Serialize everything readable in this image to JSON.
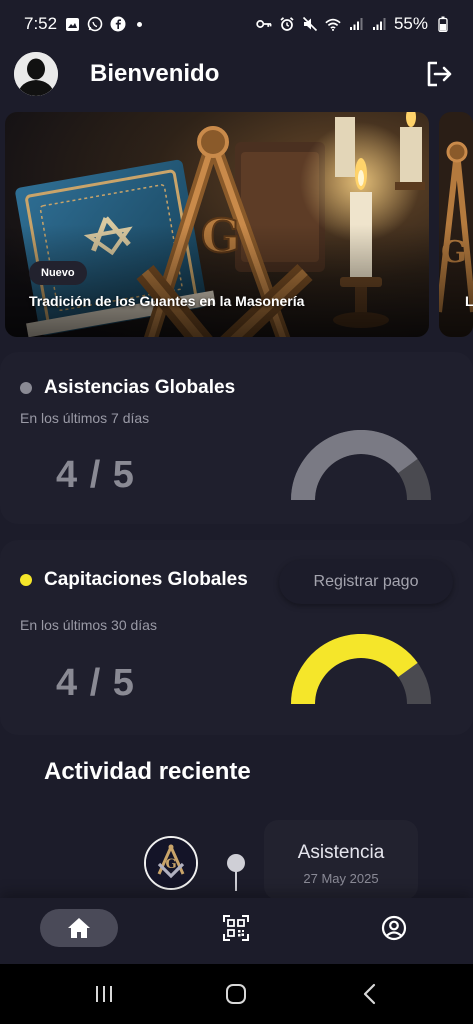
{
  "status_bar": {
    "time": "7:52",
    "battery": "55%"
  },
  "header": {
    "title": "Bienvenido"
  },
  "carousel": {
    "items": [
      {
        "tag": "Nuevo",
        "title": "Tradición de los Guantes en la Masonería"
      },
      {
        "tag": "",
        "title": "L"
      }
    ]
  },
  "attendance": {
    "title": "Asistencias Globales",
    "subtitle": "En los últimos 7 días",
    "value": "4 / 5",
    "dot_color": "#8a8a94",
    "gauge_color": "#7a7a84",
    "fraction": 0.8
  },
  "capitations": {
    "title": "Capitaciones Globales",
    "subtitle": "En los últimos 30 días",
    "value": "4 / 5",
    "button_label": "Registrar pago",
    "dot_color": "#f5e62a",
    "gauge_color": "#f5e62a",
    "fraction": 0.8
  },
  "activity": {
    "title": "Actividad reciente",
    "items": [
      {
        "label": "Asistencia",
        "date": "27 May 2025"
      }
    ]
  },
  "bottom_nav": {
    "items": [
      "home-icon",
      "qr-code-icon",
      "profile-icon"
    ],
    "active": "home-icon"
  },
  "colors": {
    "background": "#1c1c2a",
    "card": "#1f1f2d",
    "accent_yellow": "#f5e62a"
  }
}
